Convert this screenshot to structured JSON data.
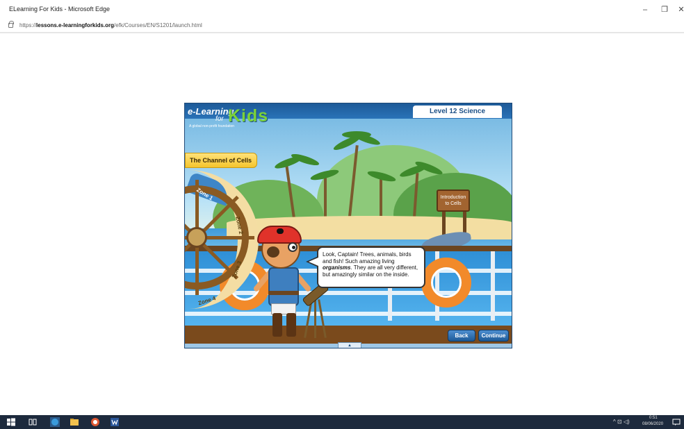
{
  "window": {
    "title": "ELearning For Kids - Microsoft Edge",
    "minimize_glyph": "–",
    "restore_glyph": "❐",
    "close_glyph": "✕"
  },
  "address": {
    "prefix": "https://",
    "domain": "lessons.e-learningforkids.org",
    "path": "/efk/Courses/EN/S1201/launch.html"
  },
  "game": {
    "logo_e": "e-Learning",
    "logo_for": "for",
    "logo_kids": "Kids",
    "logo_sub": "A global non-profit foundation",
    "level": "Level 12 Science",
    "topic": "The Channel of Cells",
    "sign": [
      "Introduction",
      "to Cells"
    ],
    "zones": [
      "Zone 1",
      "Zone 2",
      "Zone 3",
      "Zone 4"
    ],
    "speech_before": "Look, Captain! Trees, animals, birds and fish! Such amazing living ",
    "speech_emphasis": "organisms",
    "speech_after": ". They are all very different, but amazingly similar on the inside.",
    "back_label": "Back",
    "continue_label": "Continue",
    "bottom_tab": "▲"
  },
  "taskbar": {
    "icons": [
      "windows-start-icon",
      "task-view-icon",
      "edge-browser-icon",
      "file-explorer-icon",
      "duckduckgo-icon",
      "word-icon"
    ],
    "tray_glyphs": "^ ⊡ ◁)",
    "time": "0:51",
    "date": "08/06/2020"
  }
}
